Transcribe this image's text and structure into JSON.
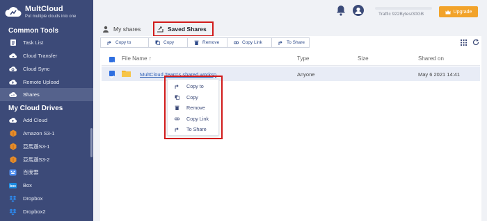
{
  "brand": {
    "name": "MultCloud",
    "tagline": "Put multiple clouds into one"
  },
  "sidebar": {
    "common_tools_heading": "Common Tools",
    "common_tools": [
      {
        "label": "Task List",
        "icon": "task-list-icon"
      },
      {
        "label": "Cloud Transfer",
        "icon": "cloud-transfer-icon"
      },
      {
        "label": "Cloud Sync",
        "icon": "cloud-sync-icon"
      },
      {
        "label": "Remote Upload",
        "icon": "remote-upload-icon"
      },
      {
        "label": "Shares",
        "icon": "shares-icon",
        "active": true
      }
    ],
    "drives_heading": "My Cloud Drives",
    "drives": [
      {
        "label": "Add Cloud",
        "icon": "add-cloud-icon"
      },
      {
        "label": "Amazon S3-1",
        "icon": "amazon-s3-icon"
      },
      {
        "label": "亞馬遜S3-1",
        "icon": "amazon-s3-icon"
      },
      {
        "label": "亞馬遜S3-2",
        "icon": "amazon-s3-icon"
      },
      {
        "label": "百度雲",
        "icon": "baidu-icon"
      },
      {
        "label": "Box",
        "icon": "box-icon"
      },
      {
        "label": "Dropbox",
        "icon": "dropbox-icon"
      },
      {
        "label": "Dropbox2",
        "icon": "dropbox-icon"
      }
    ]
  },
  "header": {
    "traffic_text": "Traffic 922Bytes/30GB",
    "upgrade_label": "Upgrade"
  },
  "tabs": {
    "my_shares": "My shares",
    "saved_shares": "Saved Shares"
  },
  "toolbar": {
    "copy_to": "Copy to",
    "copy": "Copy",
    "remove": "Remove",
    "copy_link": "Copy Link",
    "to_share": "To Share"
  },
  "table": {
    "columns": {
      "file_name": "File Name",
      "sort_indicator": "↑",
      "type": "Type",
      "size": "Size",
      "shared_on": "Shared on"
    },
    "rows": [
      {
        "file_name": "MultCloud Team's shared worksp",
        "type": "Anyone",
        "size": "",
        "shared_on": "May 6 2021 14:41",
        "checked": true
      }
    ]
  },
  "context_menu": {
    "items": [
      "Copy to",
      "Copy",
      "Remove",
      "Copy Link",
      "To Share"
    ]
  },
  "colors": {
    "sidebar_bg": "#3c4a78",
    "accent_blue": "#2f6fe0",
    "upgrade_orange": "#f2a32a",
    "highlight_red": "#d11a1a",
    "link_blue": "#2d5fb5"
  }
}
